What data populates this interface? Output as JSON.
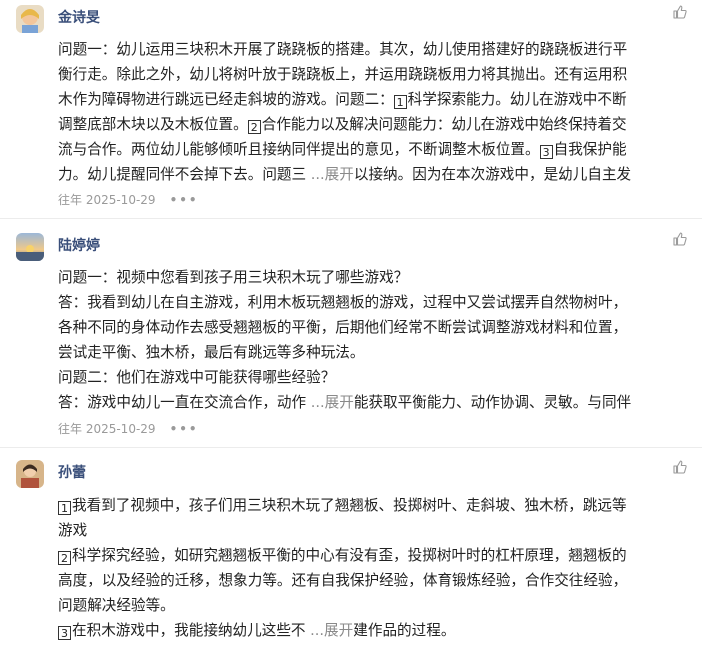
{
  "comments": [
    {
      "name": "金诗旻",
      "lines": [
        "问题一：幼儿运用三块积木开展了跷跷板的搭建。其次，幼儿使用搭建好的跷跷板进行平",
        "衡行走。除此之外，幼儿将树叶放于跷跷板上，并运用跷跷板用力将其抛出。还有运用积",
        "木作为障碍物进行跳远已经走斜坡的游戏。问题二：",
        "科学探索能力。幼儿在游戏中不断",
        "调整底部木块以及木板位置。",
        "合作能力以及解决问题能力：幼儿在游戏中始终保持着交",
        "流与合作。两位幼儿能够倾听且接纳同伴提出的意见，不断调整木板位置。",
        "自我保护能",
        "力。幼儿提醒同伴不会掉下去。问题三 ",
        "以接纳。因为在本次游戏中，是幼儿自主发"
      ],
      "nums": [
        "1",
        "2",
        "3"
      ],
      "expand": "...展开",
      "date": "往年 2025-10-29",
      "more": "•••"
    },
    {
      "name": "陆婷婷",
      "lines": [
        "问题一：视频中您看到孩子用三块积木玩了哪些游戏？",
        "答：我看到幼儿在自主游戏，利用木板玩翘翘板的游戏，过程中又尝试摆弄自然物树叶，",
        "各种不同的身体动作去感受翘翘板的平衡，后期他们经常不断尝试调整游戏材料和位置，",
        "尝试走平衡、独木桥，最后有跳远等多种玩法。",
        "问题二：他们在游戏中可能获得哪些经验？",
        "答：游戏中幼儿一直在交流合作，动作 ",
        "能获取平衡能力、动作协调、灵敏。与同伴"
      ],
      "expand": "...展开",
      "date": "往年 2025-10-29",
      "more": "•••"
    },
    {
      "name": "孙蕾",
      "lines": [
        "我看到了视频中，孩子们用三块积木玩了翘翘板、投掷树叶、走斜坡、独木桥，跳远等",
        "游戏",
        "科学探究经验，如研究翘翘板平衡的中心有没有歪，投掷树叶时的杠杆原理，翘翘板的",
        "高度，以及经验的迁移，想象力等。还有自我保护经验，体育锻炼经验，合作交往经验，",
        "问题解决经验等。",
        "在积木游戏中，我能接纳幼儿这些不 ",
        "建作品的过程。"
      ],
      "nums": [
        "1",
        "2",
        "3"
      ],
      "expand": "...展开"
    }
  ],
  "colors": {
    "name": "#3a4f7a",
    "meta": "#9a9a9a",
    "expand": "#8a8a8a"
  },
  "icons": {
    "like": "thumbs-up-icon",
    "more": "more-dots-icon"
  }
}
